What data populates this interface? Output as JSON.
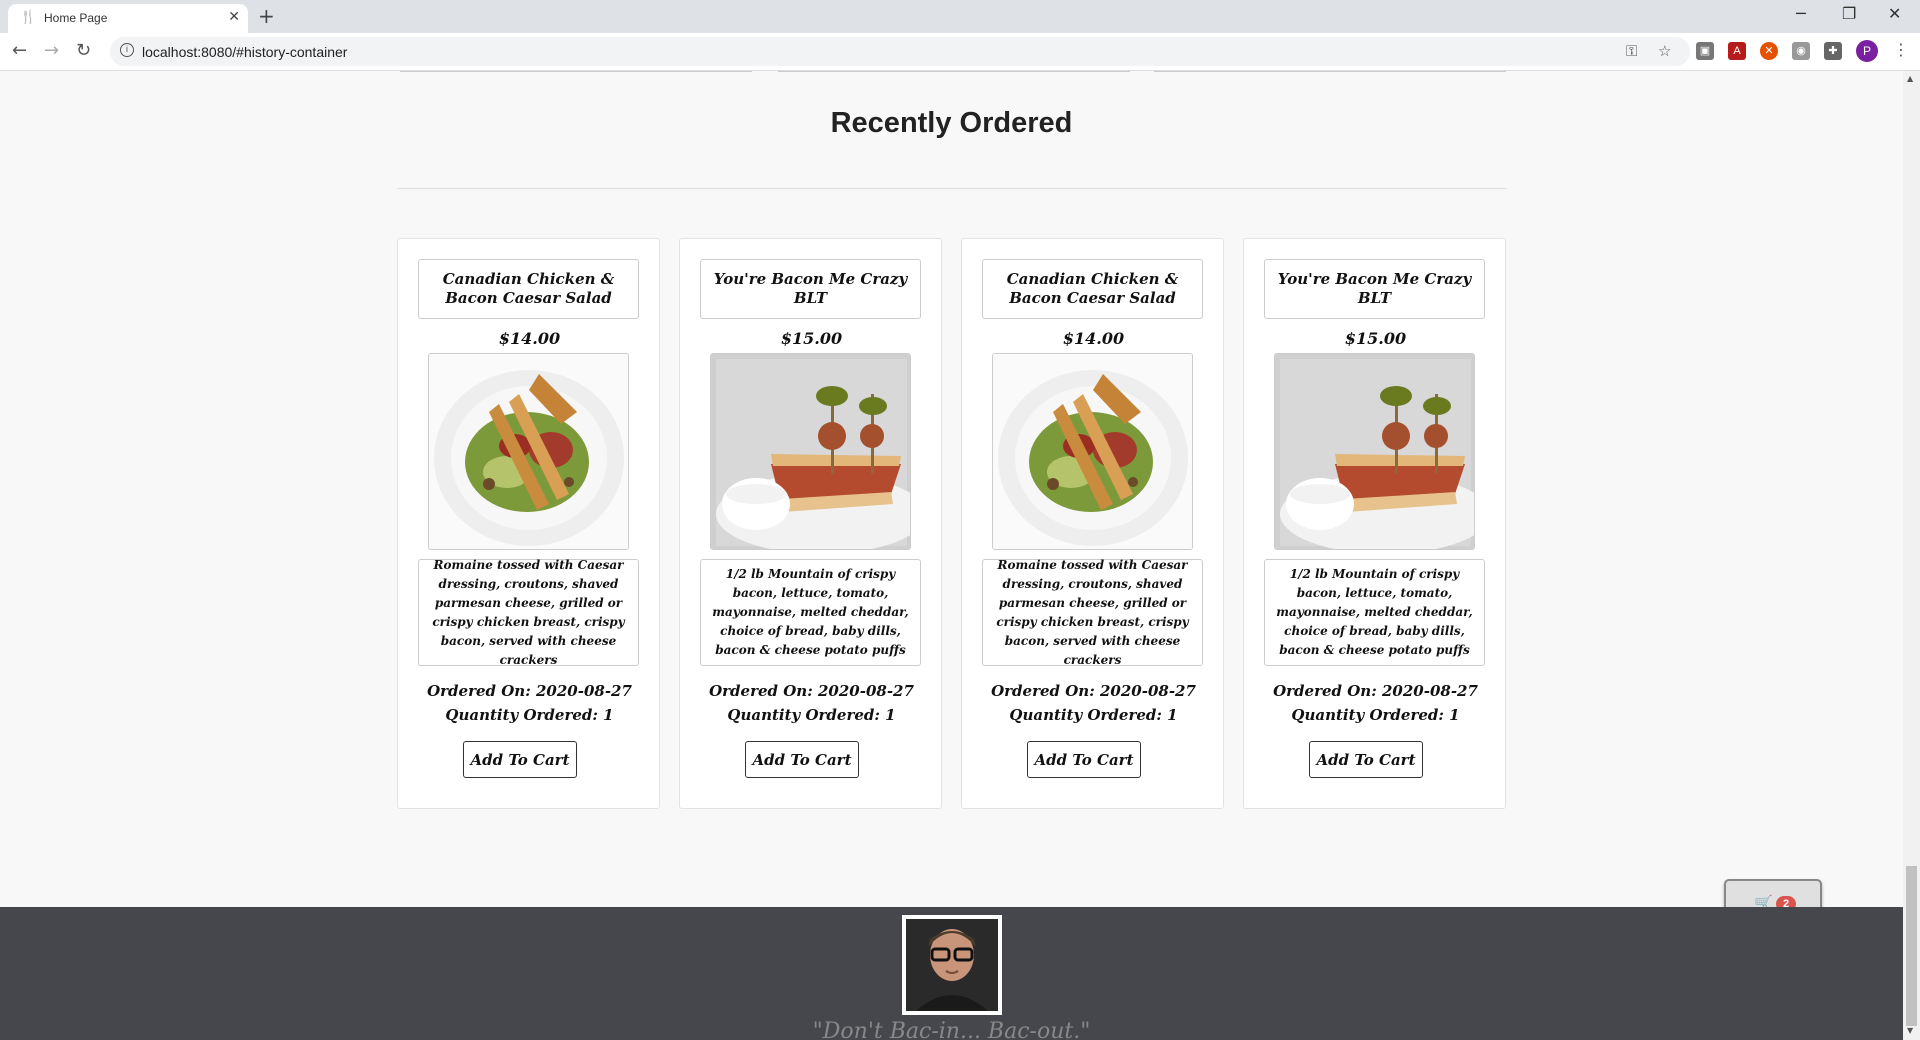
{
  "browser": {
    "tab_title": "Home Page",
    "tab_icon": "fork-knife-icon",
    "url": "localhost:8080/#history-container",
    "profile_initial": "P"
  },
  "section": {
    "title": "Recently Ordered"
  },
  "orders": [
    {
      "name": "Canadian Chicken & Bacon Caesar Salad",
      "price": "$14.00",
      "image": "caesar-salad",
      "description": "Romaine tossed with Caesar dressing, croutons, shaved parmesan cheese, grilled or crispy chicken breast, crispy bacon, served with cheese crackers",
      "ordered_on": "Ordered On: 2020-08-27",
      "quantity": "Quantity Ordered: 1",
      "button": "Add To Cart"
    },
    {
      "name": "You're Bacon Me Crazy BLT",
      "price": "$15.00",
      "image": "blt-sandwich",
      "description": "1/2 lb Mountain of crispy bacon, lettuce, tomato, mayonnaise, melted cheddar, choice of bread, baby dills, bacon & cheese potato puffs",
      "ordered_on": "Ordered On: 2020-08-27",
      "quantity": "Quantity Ordered: 1",
      "button": "Add To Cart"
    },
    {
      "name": "Canadian Chicken & Bacon Caesar Salad",
      "price": "$14.00",
      "image": "caesar-salad",
      "description": "Romaine tossed with Caesar dressing, croutons, shaved parmesan cheese, grilled or crispy chicken breast, crispy bacon, served with cheese crackers",
      "ordered_on": "Ordered On: 2020-08-27",
      "quantity": "Quantity Ordered: 1",
      "button": "Add To Cart"
    },
    {
      "name": "You're Bacon Me Crazy BLT",
      "price": "$15.00",
      "image": "blt-sandwich",
      "description": "1/2 lb Mountain of crispy bacon, lettuce, tomato, mayonnaise, melted cheddar, choice of bread, baby dills, bacon & cheese potato puffs",
      "ordered_on": "Ordered On: 2020-08-27",
      "quantity": "Quantity Ordered: 1",
      "button": "Add To Cart"
    }
  ],
  "cart": {
    "count": "2",
    "icon": "cart-icon"
  },
  "footer": {
    "quote": "\"Don't Bac-in... Bac-out.\""
  },
  "colors": {
    "footer_bg": "#45474c",
    "badge": "#d9534f",
    "page_bg": "#f8f8f8"
  }
}
